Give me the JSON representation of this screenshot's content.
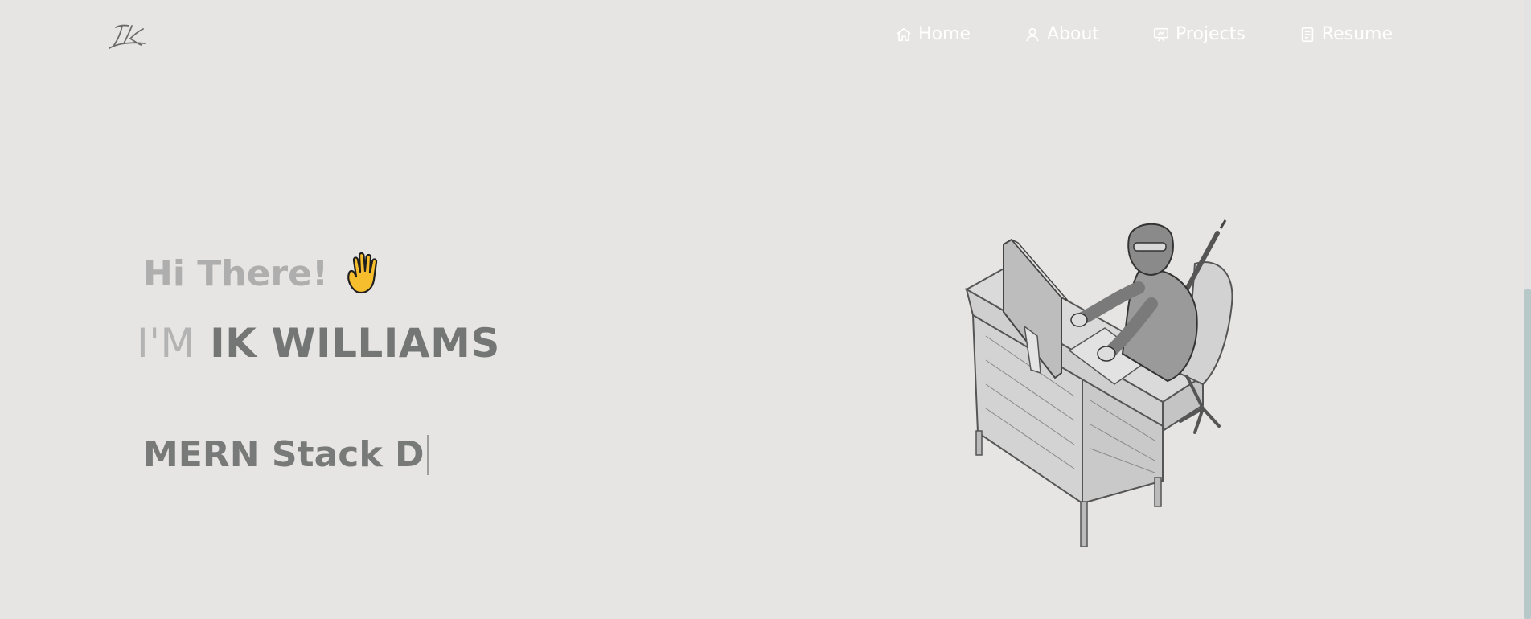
{
  "nav": {
    "items": [
      {
        "label": "Home",
        "icon": "home-icon"
      },
      {
        "label": "About",
        "icon": "user-icon"
      },
      {
        "label": "Projects",
        "icon": "projects-icon"
      },
      {
        "label": "Resume",
        "icon": "document-icon"
      }
    ]
  },
  "hero": {
    "greeting": "Hi There!",
    "wave_icon": "raised-hand-icon",
    "im_label": "I'M",
    "name": "IK WILLIAMS",
    "typed_role": "MERN Stack D"
  },
  "colors": {
    "background": "#e6e5e3",
    "nav_text": "#ffffff",
    "greeting": "#aeaeae",
    "name": "#747575",
    "role": "#787979",
    "wave": "#f6bd2c"
  }
}
